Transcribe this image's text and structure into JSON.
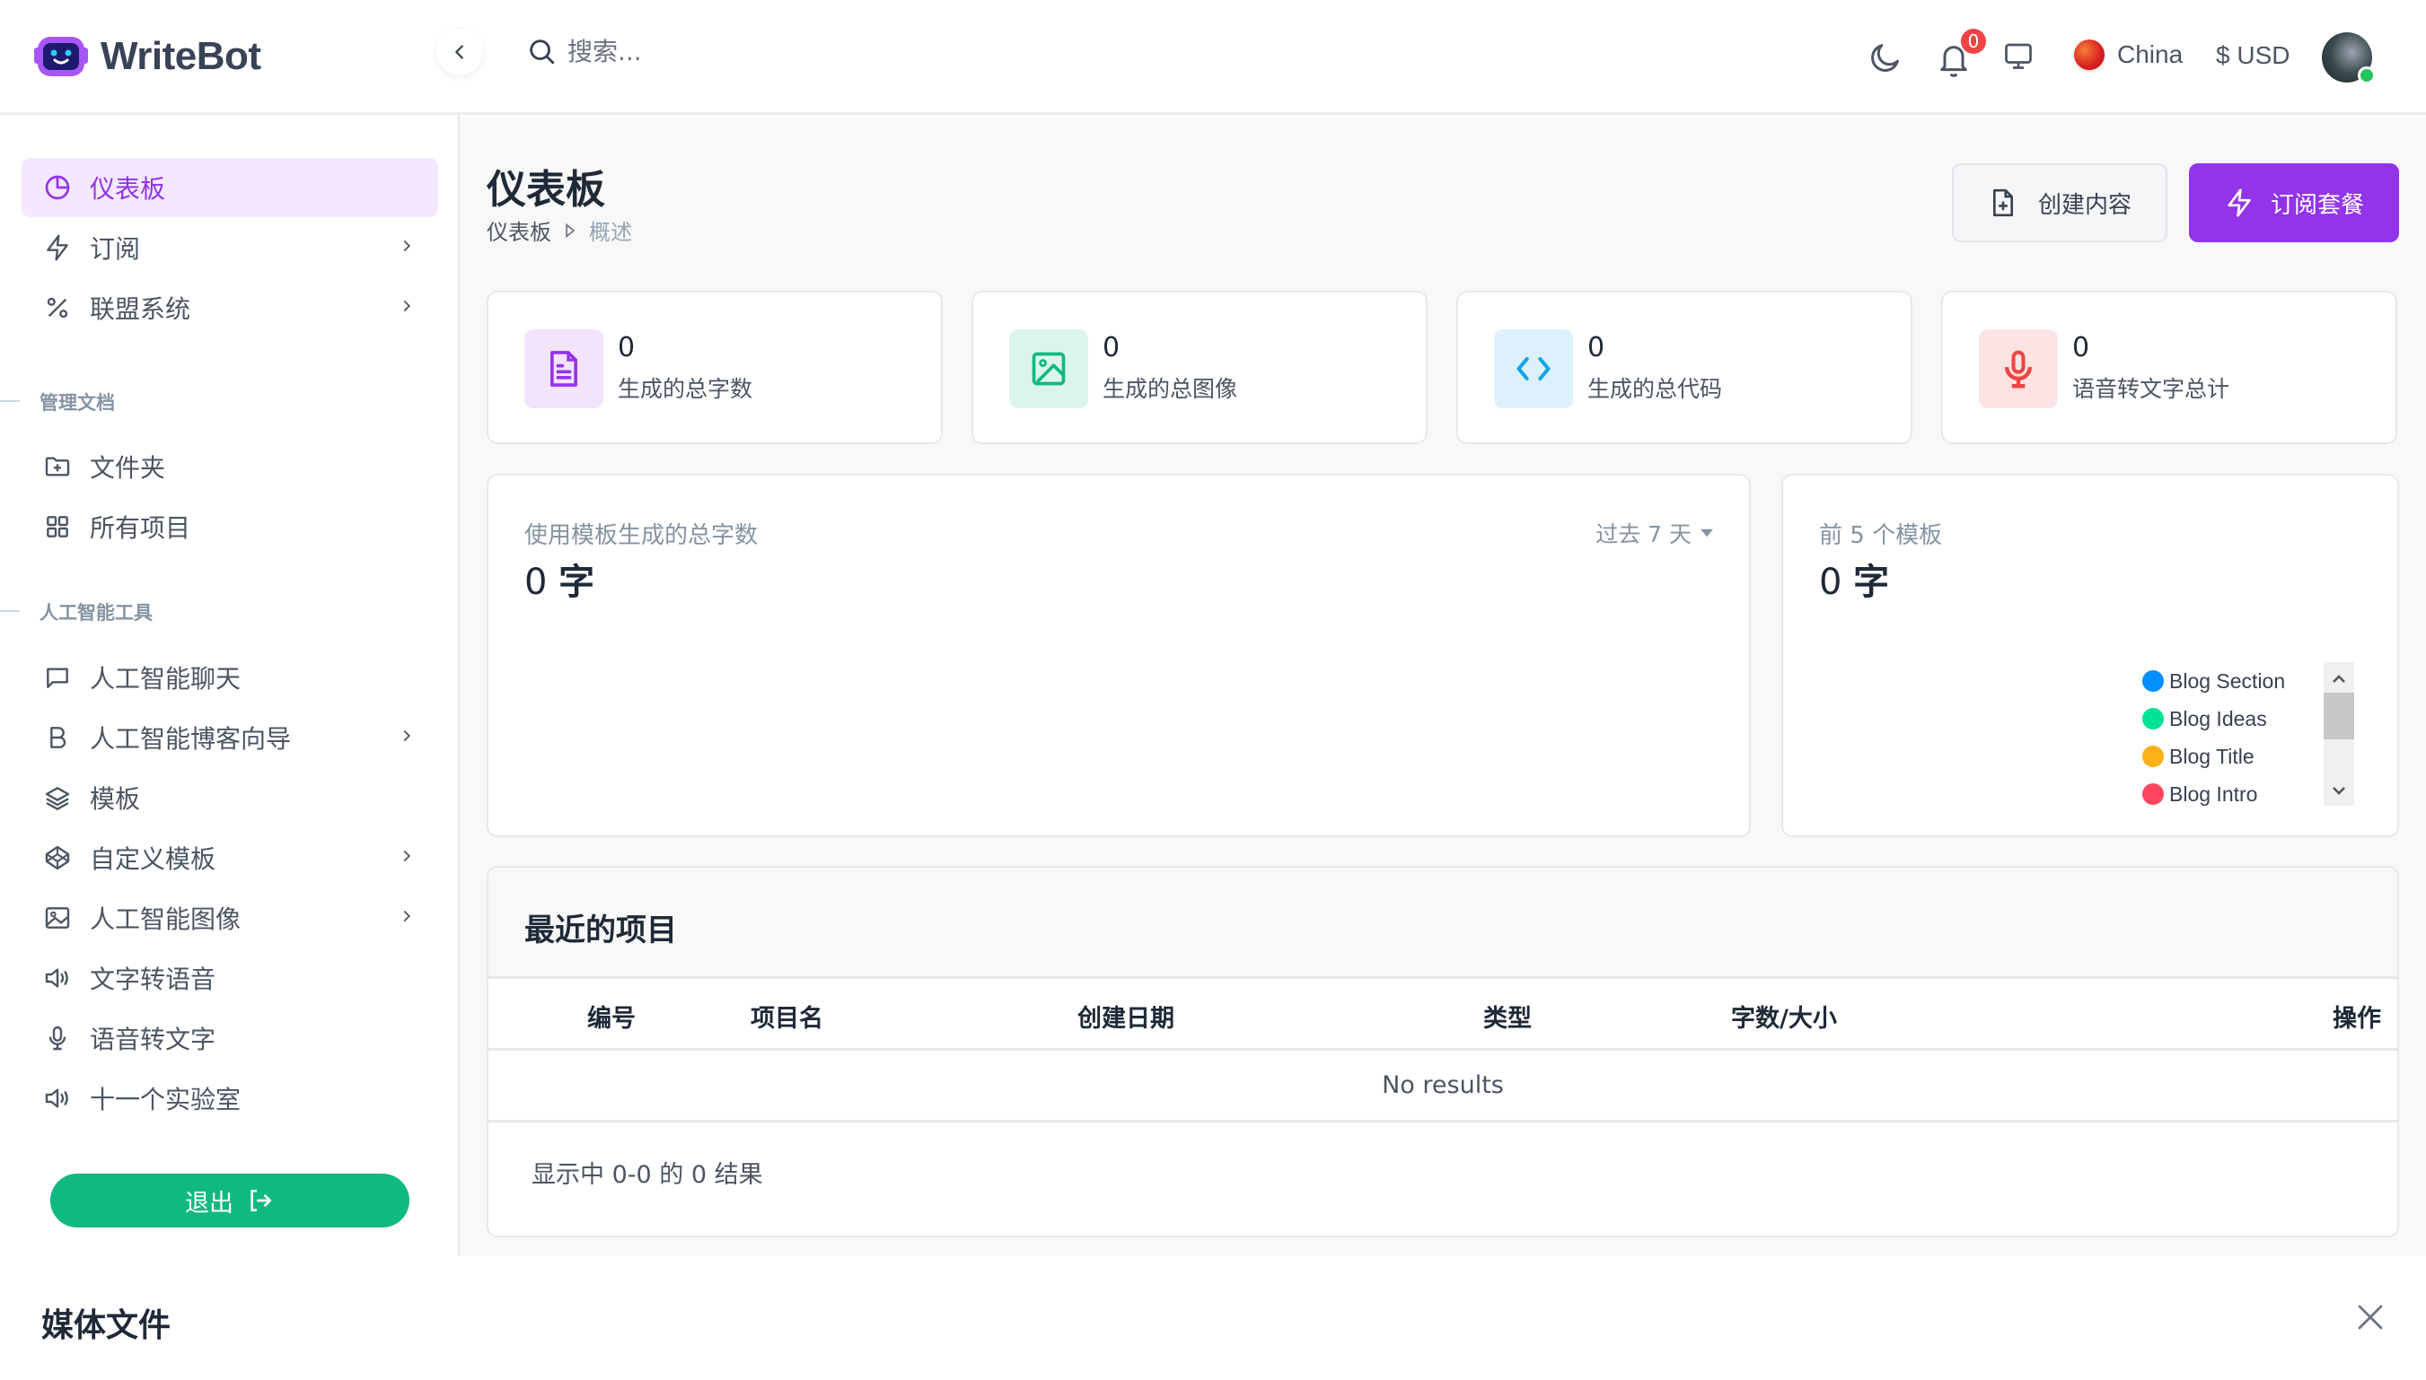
{
  "header": {
    "app_name": "WriteBot",
    "search_placeholder": "搜索...",
    "notification_count": "0",
    "country": "China",
    "currency": "$ USD",
    "icons": [
      "collapse-chevron-left-icon",
      "search-icon",
      "moon-icon",
      "bell-icon",
      "monitor-icon",
      "flag-icon",
      "avatar"
    ]
  },
  "sidebar": {
    "items": [
      {
        "label": "仪表板",
        "icon": "pie-chart-icon",
        "active": true
      },
      {
        "label": "订阅",
        "icon": "lightning-icon",
        "has_children": true
      },
      {
        "label": "联盟系统",
        "icon": "percent-icon",
        "has_children": true
      }
    ],
    "sections": [
      {
        "title": "管理文档",
        "items": [
          {
            "label": "文件夹",
            "icon": "folder-plus-icon"
          },
          {
            "label": "所有项目",
            "icon": "grid-icon"
          }
        ]
      },
      {
        "title": "人工智能工具",
        "items": [
          {
            "label": "人工智能聊天",
            "icon": "chat-icon"
          },
          {
            "label": "人工智能博客向导",
            "icon": "letter-b-icon",
            "has_children": true
          },
          {
            "label": "模板",
            "icon": "layers-icon"
          },
          {
            "label": "自定义模板",
            "icon": "codepen-icon",
            "has_children": true
          },
          {
            "label": "人工智能图像",
            "icon": "image-icon",
            "has_children": true
          },
          {
            "label": "文字转语音",
            "icon": "speaker-icon"
          },
          {
            "label": "语音转文字",
            "icon": "microphone-icon"
          },
          {
            "label": "十一个实验室",
            "icon": "speaker-icon"
          }
        ]
      }
    ],
    "logout_label": "退出"
  },
  "main": {
    "title": "仪表板",
    "breadcrumb": [
      "仪表板",
      "概述"
    ],
    "create_button": "创建内容",
    "subscribe_button": "订阅套餐",
    "colors": {
      "accent": "#9333ea",
      "success": "#10b981"
    },
    "stats": [
      {
        "value": "0",
        "label": "生成的总字数",
        "icon": "document-icon",
        "color": "#9333ea",
        "bg": "#f3e3fc"
      },
      {
        "value": "0",
        "label": "生成的总图像",
        "icon": "image-icon",
        "color": "#10b981",
        "bg": "#dcf5ec"
      },
      {
        "value": "0",
        "label": "生成的总代码",
        "icon": "code-icon",
        "color": "#0ea5e9",
        "bg": "#dcf1fb"
      },
      {
        "value": "0",
        "label": "语音转文字总计",
        "icon": "microphone-icon",
        "color": "#ef4444",
        "bg": "#fde4e4"
      }
    ],
    "usage_card": {
      "title": "使用模板生成的总字数",
      "value": "0",
      "unit": "字",
      "range": "过去 7 天"
    },
    "top_templates_card": {
      "title": "前 5 个模板",
      "value": "0",
      "unit": "字",
      "legend": [
        {
          "label": "Blog Section",
          "color": "#008ffb"
        },
        {
          "label": "Blog Ideas",
          "color": "#00e396"
        },
        {
          "label": "Blog Title",
          "color": "#feb019"
        },
        {
          "label": "Blog Intro",
          "color": "#ff4560"
        }
      ]
    },
    "recent_projects": {
      "title": "最近的项目",
      "columns": [
        "编号",
        "项目名",
        "创建日期",
        "类型",
        "字数/大小",
        "操作"
      ],
      "rows": [],
      "empty_text": "No results",
      "pager_text": "显示中 0-0 的 0 结果"
    }
  },
  "media_panel": {
    "title": "媒体文件"
  }
}
